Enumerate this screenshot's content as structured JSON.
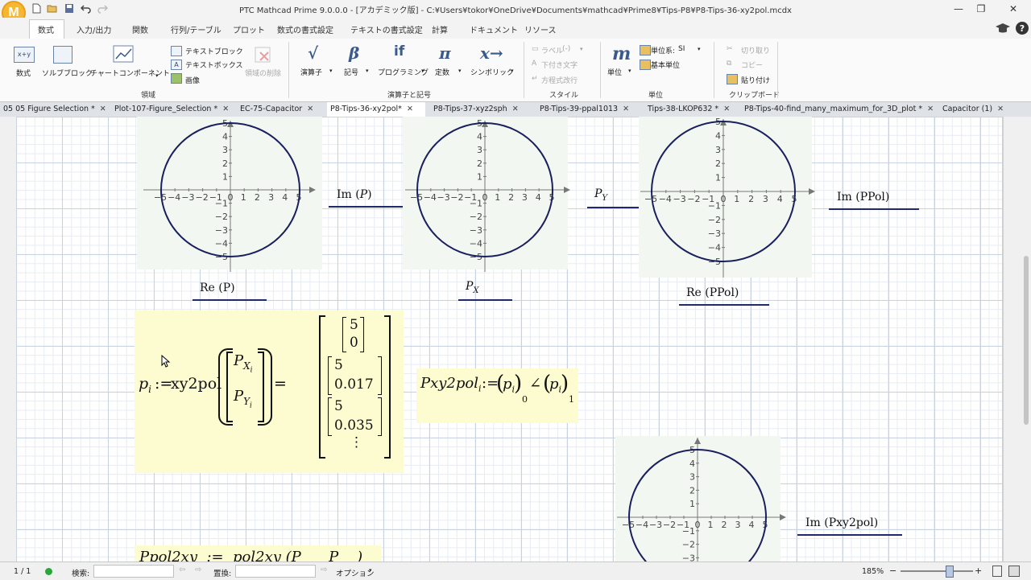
{
  "window": {
    "title": "PTC Mathcad Prime 9.0.0.0 - [アカデミック版] - C:¥Users¥tokor¥OneDrive¥Documents¥mathcad¥Prime8¥Tips-P8¥P8-Tips-36-xy2pol.mcdx",
    "logo": "M"
  },
  "ribbon_tabs": [
    "数式",
    "入力/出力",
    "関数",
    "行列/テーブル",
    "プロット",
    "数式の書式設定",
    "テキストの書式設定",
    "計算",
    "ドキュメント",
    "リソース"
  ],
  "ribbon": {
    "math_label": "数式",
    "solve_block_label": "ソルブブロック",
    "chart_label": "チャートコンポーネント",
    "text_block_label": "テキストブロック",
    "text_box_label": "テキストボックス",
    "image_label": "画像",
    "delete_region_label": "領域の削除",
    "group_regions": "領域",
    "operators_label": "演算子",
    "symbols_label": "記号",
    "programming_label": "プログラミング",
    "constants_label": "定数",
    "symbolic_label": "シンボリック",
    "group_operators": "演算子と記号",
    "label_label": "ラベル",
    "label_value": "(-)",
    "subscript_label": "下付き文字",
    "eq_wrap_label": "方程式改行",
    "group_style": "スタイル",
    "units_label": "単位",
    "unit_system_label": "単位系:",
    "unit_system_value": "SI",
    "base_units_label": "基本単位",
    "group_units": "単位",
    "cut_label": "切り取り",
    "copy_label": "コピー",
    "paste_label": "貼り付け",
    "group_clipboard": "クリップボード",
    "icon_math": "x+y",
    "icon_operators": "√",
    "icon_symbols": "β",
    "icon_programming": "if",
    "icon_constants": "π",
    "icon_symbolic": "x→",
    "icon_units": "m"
  },
  "doc_tabs": [
    {
      "label": "05 05 Figure Selection *"
    },
    {
      "label": "Plot-107-Figure_Selection *"
    },
    {
      "label": "EC-75-Capacitor"
    },
    {
      "label": "P8-Tips-36-xy2pol*"
    },
    {
      "label": "P8-Tips-37-xyz2sph"
    },
    {
      "label": "P8-Tips-39-ppal1013"
    },
    {
      "label": "Tips-38-LKOP632 *"
    },
    {
      "label": "P8-Tips-40-find_many_maximum_for_3D_plot *"
    },
    {
      "label": "Capacitor (1)"
    }
  ],
  "close_glyph": "✕",
  "plots": {
    "y_labels_p1": [
      "Im",
      "(",
      "P",
      ")"
    ],
    "x_label_p1": "Re (P)",
    "y_label_p2_main": "P",
    "y_label_p2_sub": "Y",
    "x_label_p2_main": "P",
    "x_label_p2_sub": "X",
    "y_label_p3": "Im (PPol)",
    "x_label_p3": "Re (PPol)",
    "y_label_p4": "Im (Pxy2pol)",
    "x_ticks": [
      "−5",
      "−4",
      "−3",
      "−2",
      "−1",
      "0",
      "1",
      "2",
      "3",
      "4",
      "5"
    ],
    "y_ticks": [
      "5",
      "4",
      "3",
      "2",
      "1",
      "0",
      "−1",
      "−2",
      "−3",
      "−4",
      "−5"
    ],
    "y_ticks_p4": [
      "5",
      "4",
      "3",
      "2",
      "1",
      "0",
      "−1",
      "−2",
      "−3"
    ]
  },
  "chart_data": [
    {
      "type": "line",
      "series": [
        {
          "values_desc": "circle radius 5",
          "radius": 5
        }
      ],
      "xlim": [
        -5,
        5
      ],
      "ylim": [
        -5,
        5
      ],
      "xlabel": "Re (P)",
      "ylabel": "Im (P)"
    },
    {
      "type": "line",
      "series": [
        {
          "radius": 5
        }
      ],
      "xlim": [
        -5,
        5
      ],
      "ylim": [
        -5,
        5
      ],
      "xlabel": "P_X",
      "ylabel": "P_Y"
    },
    {
      "type": "line",
      "series": [
        {
          "radius": 5
        }
      ],
      "xlim": [
        -5,
        5
      ],
      "ylim": [
        -5,
        5
      ],
      "xlabel": "Re (PPol)",
      "ylabel": "Im (PPol)"
    },
    {
      "type": "line",
      "series": [
        {
          "radius": 5
        }
      ],
      "xlim": [
        -5,
        5
      ],
      "ylim": [
        -3,
        5
      ],
      "ylabel": "Im (Pxy2pol)"
    }
  ],
  "math1": {
    "lhs": "p",
    "lhs_sub": "i",
    "assign": ":=",
    "func": "xy2pol",
    "arg1": "P",
    "arg1_sub": "X",
    "arg2": "P",
    "arg2_sub": "Y",
    "arg_sub_i": "i",
    "equals": "=",
    "results": [
      [
        "5",
        "0"
      ],
      [
        "5",
        "0.017"
      ],
      [
        "5",
        "0.035"
      ]
    ],
    "ellipsis": "⋮"
  },
  "math2": {
    "lhs": "Pxy2pol",
    "lhs_sub": "i",
    "assign": ":=",
    "p": "p",
    "sub_i": "i",
    "idx0": "0",
    "angle": "∠",
    "idx1": "1"
  },
  "math3_partial": "Ppol2xy  :=  pol2xy (P      P    )",
  "status": {
    "page": "1 / 1",
    "search_label": "検索:",
    "replace_label": "置換:",
    "options_label": "オプション",
    "zoom": "185%"
  }
}
